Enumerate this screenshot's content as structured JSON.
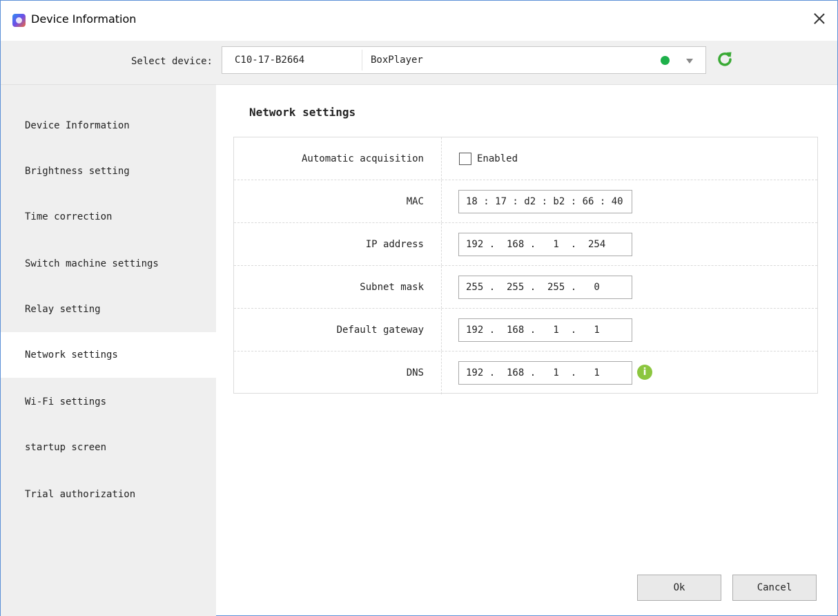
{
  "window": {
    "title": "Device Information"
  },
  "device_bar": {
    "label": "Select device:",
    "device_id": "C10-17-B2664",
    "device_name": "BoxPlayer",
    "status_color": "#1db04a"
  },
  "sidebar": {
    "items": [
      {
        "label": "Device Information"
      },
      {
        "label": "Brightness setting"
      },
      {
        "label": "Time correction"
      },
      {
        "label": "Switch machine settings"
      },
      {
        "label": "Relay setting"
      },
      {
        "label": "Network settings",
        "active": true
      },
      {
        "label": "Wi-Fi settings"
      },
      {
        "label": "startup screen"
      },
      {
        "label": "Trial authorization"
      }
    ]
  },
  "main": {
    "section_title": "Network settings",
    "automatic": {
      "label": "Automatic acquisition",
      "checkbox_label": "Enabled",
      "checked": false
    },
    "mac": {
      "label": "MAC",
      "value": "18 : 17 : d2 : b2 : 66 : 40"
    },
    "ip": {
      "label": "IP address",
      "value": "192 .  168 .   1  .  254"
    },
    "subnet": {
      "label": "Subnet mask",
      "value": "255 .  255 .  255 .   0"
    },
    "gateway": {
      "label": "Default gateway",
      "value": "192 .  168 .   1  .   1"
    },
    "dns": {
      "label": "DNS",
      "value": "192 .  168 .   1  .   1"
    }
  },
  "buttons": {
    "ok": "Ok",
    "cancel": "Cancel"
  }
}
